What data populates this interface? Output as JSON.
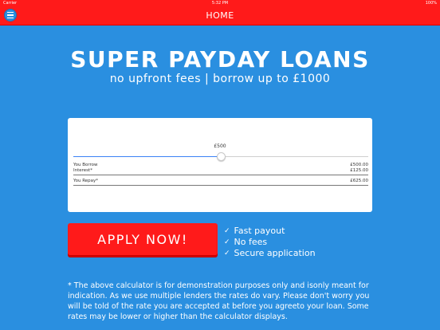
{
  "status": {
    "carrier": "Carrier",
    "time": "5:32 PM",
    "battery": "100%"
  },
  "nav": {
    "title": "HOME"
  },
  "hero": {
    "title": "SUPER PAYDAY LOANS",
    "subtitle": "no upfront fees | borrow up to £1000"
  },
  "calculator": {
    "slider_label": "£500",
    "slider_level": 0.5,
    "rows": [
      {
        "label": "You Borrow",
        "value": "£500.00"
      },
      {
        "label": "Interest*",
        "value": "£125.00"
      },
      {
        "label": "You Repay*",
        "value": "£625.00"
      }
    ]
  },
  "apply": {
    "label": "APPLY NOW!"
  },
  "features": [
    {
      "icon": "check-icon",
      "label": "Fast payout"
    },
    {
      "icon": "check-icon",
      "label": "No fees"
    },
    {
      "icon": "check-icon",
      "label": "Secure application"
    }
  ],
  "disclaimer": "* The above calculator is for demonstration purposes only and isonly meant for indication. As we use multiple lenders the rates do vary. Please don't worry you will be told of the rate you are accepted at before you agreeto your loan. Some rates may be lower or higher than the calculator displays.",
  "colors": {
    "brand_red": "#ff1a1a",
    "background_blue": "#2a8fe0",
    "slider_blue": "#3b82f6"
  }
}
